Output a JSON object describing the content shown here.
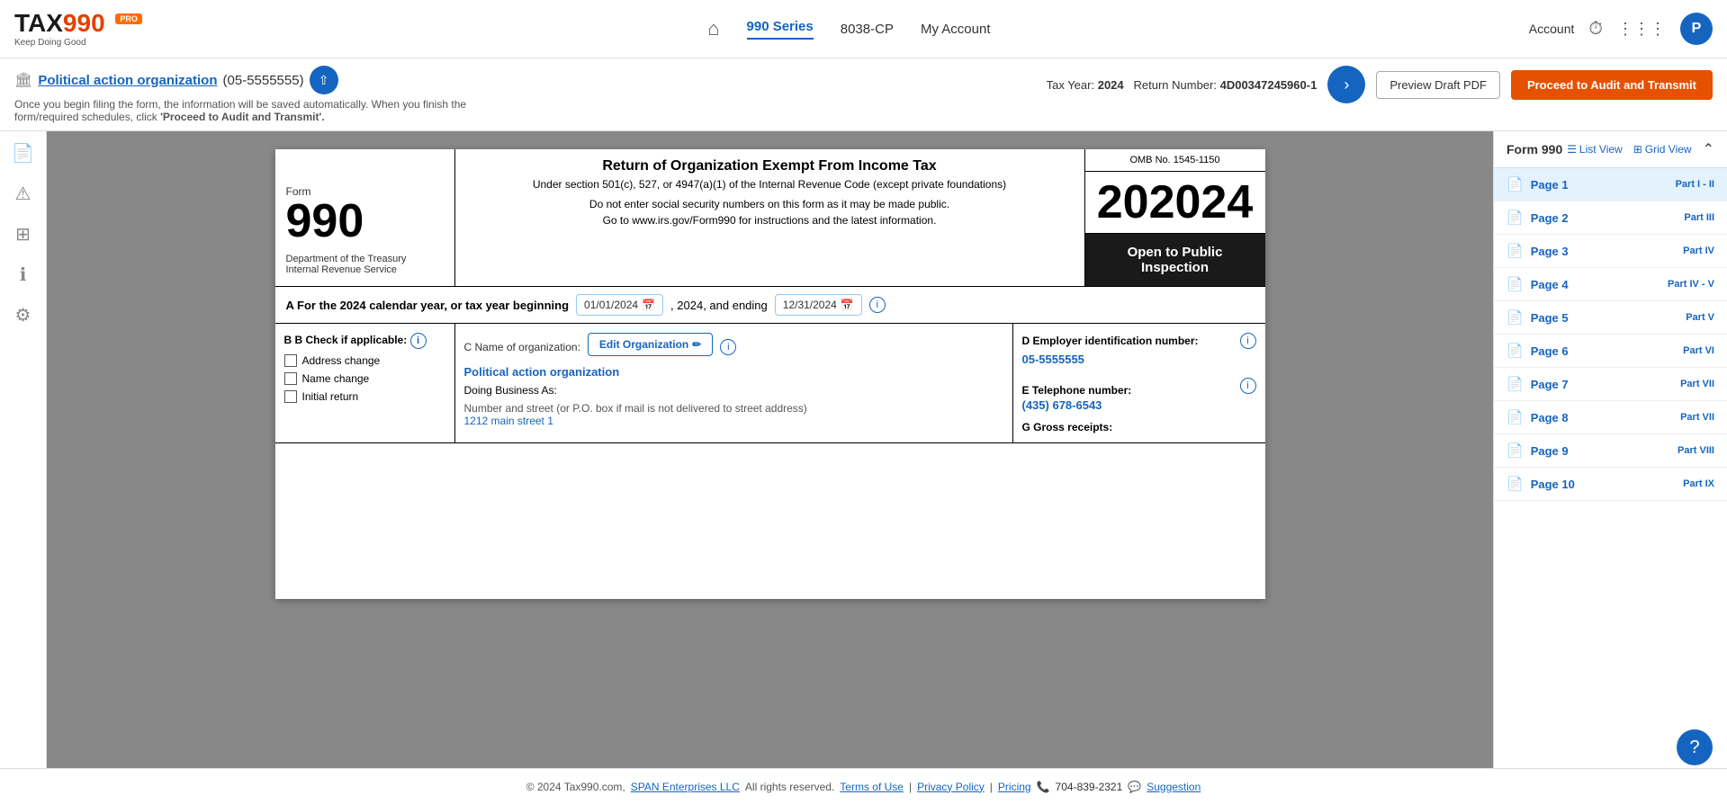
{
  "header": {
    "logo": {
      "name": "TAX990",
      "pro_label": "PRO",
      "tagline": "Keep Doing Good"
    },
    "nav": {
      "home_icon": "⌂",
      "series_label": "990 Series",
      "form_8038cp": "8038-CP",
      "my_account": "My Account"
    },
    "user": {
      "account_label": "Account",
      "avatar_letter": "P",
      "grid_icon": "⋮⋮⋮"
    }
  },
  "sub_header": {
    "org_name": "Political action organization",
    "org_ein": "(05-5555555)",
    "description_part1": "Once you begin filing the form, the information will be saved automatically. When you finish the",
    "description_part2": "form/required schedules, click ",
    "description_emphasis": "'Proceed to Audit and Transmit'.",
    "tax_year_label": "Tax Year:",
    "tax_year": "2024",
    "return_label": "Return Number:",
    "return_number": "4D00347245960-1",
    "btn_preview": "Preview Draft PDF",
    "btn_proceed": "Proceed to Audit and Transmit"
  },
  "form_paper": {
    "form_label": "Form",
    "form_number": "990",
    "dept_line1": "Department of the Treasury",
    "dept_line2": "Internal Revenue Service",
    "title": "Return of Organization Exempt From Income Tax",
    "subtitle": "Under section 501(c), 527, or 4947(a)(1) of the Internal Revenue Code (except private foundations)",
    "notice1": "Do not enter social security numbers on this form as it may be made public.",
    "notice2": "Go to www.irs.gov/Form990 for instructions and the latest information.",
    "omb": "OMB No. 1545-1150",
    "year": "2024",
    "public_inspection": "Open to Public Inspection",
    "cal_year_label": "A For the 2024 calendar year, or tax year beginning",
    "date_start": "01/01/2024",
    "date_mid": ", 2024, and ending",
    "date_end": "12/31/2024",
    "section_b_label": "B Check if applicable:",
    "checkbox_items": [
      {
        "label": "Address change",
        "checked": false
      },
      {
        "label": "Name change",
        "checked": false
      },
      {
        "label": "Initial return",
        "checked": false
      }
    ],
    "section_c_label": "C Name of organization:",
    "edit_org_btn": "Edit Organization",
    "org_name": "Political action organization",
    "doing_business": "Doing Business As:",
    "address_label": "Number and street (or P.O. box if mail is not delivered to street address)",
    "address_val": "1212 main street 1",
    "section_d_label": "D Employer identification number:",
    "ein_val": "05-5555555",
    "phone_label": "E Telephone number:",
    "phone_val": "(435) 678-6543",
    "gross_label": "G Gross receipts:"
  },
  "right_sidebar": {
    "form_label": "Form 990",
    "list_view": "List View",
    "grid_view": "Grid View",
    "pages": [
      {
        "num": "Page 1",
        "part": "Part I - II",
        "active": true
      },
      {
        "num": "Page 2",
        "part": "Part III",
        "active": false
      },
      {
        "num": "Page 3",
        "part": "Part IV",
        "active": false
      },
      {
        "num": "Page 4",
        "part": "Part IV - V",
        "active": false
      },
      {
        "num": "Page 5",
        "part": "Part V",
        "active": false
      },
      {
        "num": "Page 6",
        "part": "Part VI",
        "active": false
      },
      {
        "num": "Page 7",
        "part": "Part VII",
        "active": false
      },
      {
        "num": "Page 8",
        "part": "Part VII",
        "active": false
      },
      {
        "num": "Page 9",
        "part": "Part VIII",
        "active": false
      },
      {
        "num": "Page 10",
        "part": "Part IX",
        "active": false
      }
    ]
  },
  "left_sidebar": {
    "icons": [
      "⚑",
      "⚠",
      "⊞",
      "ℹ",
      "⚙"
    ]
  },
  "footer": {
    "copyright": "© 2024 Tax990.com,",
    "span_label": "SPAN Enterprises LLC",
    "rights": "All rights reserved.",
    "terms": "Terms of Use",
    "separator1": "|",
    "privacy": "Privacy Policy",
    "separator2": "|",
    "pricing": "Pricing",
    "phone_icon": "📞",
    "phone": "704-839-2321",
    "suggestion_icon": "💬",
    "suggestion": "Suggestion"
  },
  "help_bubble": "?"
}
